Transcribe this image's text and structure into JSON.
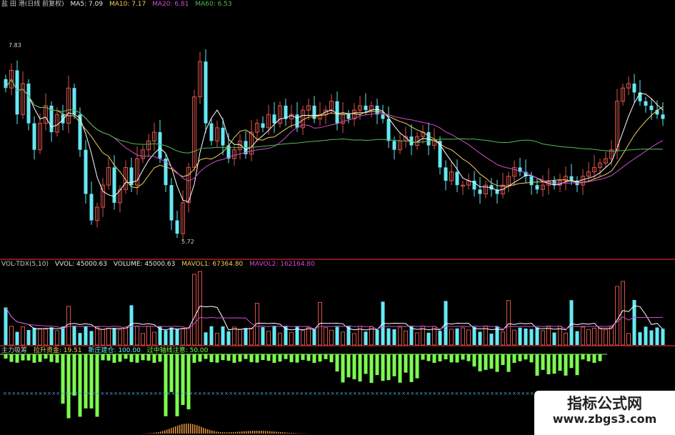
{
  "main_legend": {
    "title": "盐 田 港(日线 前复权)",
    "ma5": "MA5: 7.09",
    "ma10": "MA10: 7.17",
    "ma20": "MA20: 6.81",
    "ma60": "MA60: 6.53"
  },
  "price_markers": {
    "high": "7.83",
    "low": "5.72"
  },
  "volume_legend": {
    "title": "VOL-TDX(5,10)",
    "vvol": "VVOL: 45000.63",
    "volume": "VOLUME: 45000.63",
    "mavol1": "MAVOL1: 67364.80",
    "mavol2": "MAVOL2: 162164.80"
  },
  "indicator_legend": {
    "title": "主力吸筹",
    "lashang": "拉升资金: 19.51",
    "zhuangjia": "新庄建仓: 100.00",
    "caution": "过中轴线注意: 50.00"
  },
  "watermark": {
    "title": "指标公式网",
    "url": "www.zbgs3.com"
  },
  "colors": {
    "up": "#d9534a",
    "down": "#66e8f4",
    "ma5": "#ffffff",
    "ma10": "#f0d060",
    "ma20": "#d04cd0",
    "ma60": "#4fbf4f",
    "indicator_bar": "#7cfc4e",
    "separator": "#b02020"
  },
  "chart_data": {
    "type": "candlestick",
    "symbol": "盐田港",
    "price_range": [
      5.5,
      8.3
    ],
    "highest_label": 7.83,
    "lowest_label": 5.72,
    "series_names": [
      "MA5",
      "MA10",
      "MA20",
      "MA60"
    ],
    "ma_latest": {
      "MA5": 7.09,
      "MA10": 7.17,
      "MA20": 6.81,
      "MA60": 6.53
    },
    "close": [
      7.4,
      7.6,
      7.1,
      7.45,
      7.0,
      6.7,
      7.0,
      7.2,
      6.9,
      7.1,
      7.0,
      7.4,
      7.1,
      6.7,
      6.2,
      5.9,
      6.05,
      6.3,
      6.5,
      6.1,
      6.25,
      6.5,
      6.3,
      6.6,
      6.7,
      6.8,
      6.9,
      6.6,
      6.3,
      5.9,
      5.75,
      6.1,
      6.5,
      7.3,
      7.7,
      7.0,
      6.8,
      6.95,
      6.75,
      6.6,
      6.7,
      6.8,
      6.65,
      6.9,
      7.0,
      6.95,
      7.1,
      7.0,
      7.2,
      7.05,
      7.1,
      6.95,
      7.15,
      7.2,
      7.05,
      7.1,
      7.15,
      7.25,
      7.0,
      7.1,
      7.05,
      7.15,
      7.2,
      7.15,
      7.2,
      7.1,
      7.05,
      6.8,
      6.7,
      6.8,
      6.85,
      6.75,
      6.85,
      6.9,
      6.75,
      6.8,
      6.5,
      6.35,
      6.45,
      6.3,
      6.3,
      6.35,
      6.25,
      6.2,
      6.3,
      6.25,
      6.2,
      6.3,
      6.4,
      6.5,
      6.45,
      6.4,
      6.3,
      6.25,
      6.3,
      6.35,
      6.3,
      6.35,
      6.4,
      6.35,
      6.3,
      6.4,
      6.45,
      6.5,
      6.55,
      6.6,
      6.7,
      7.25,
      7.4,
      7.45,
      7.35,
      7.25,
      7.2,
      7.15,
      7.1,
      7.05
    ],
    "volume_mavol1": 67364.8,
    "volume_mavol2": 162164.8,
    "volume_latest": 45000.63
  }
}
